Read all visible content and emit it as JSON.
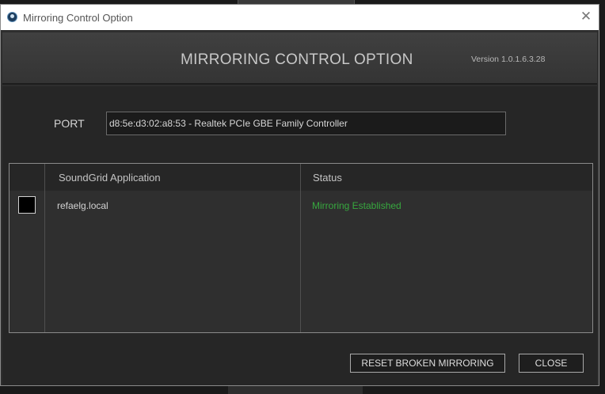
{
  "window": {
    "title": "Mirroring Control Option",
    "close_glyph": "✕"
  },
  "header": {
    "title": "MIRRORING CONTROL OPTION",
    "version": "Version 1.0.1.6.3.28"
  },
  "port": {
    "label": "PORT",
    "value": "d8:5e:d3:02:a8:53 - Realtek PCIe GBE Family Controller"
  },
  "table": {
    "columns": [
      "SoundGrid Application",
      "Status"
    ],
    "rows": [
      {
        "application": "refaelg.local",
        "status": "Mirroring Established",
        "checked": false
      }
    ]
  },
  "buttons": {
    "reset_label": "RESET BROKEN MIRRORING",
    "close_label": "CLOSE"
  },
  "colors": {
    "status_ok": "#37a83f",
    "background": "#262626"
  },
  "icons": {
    "app": "soundgrid-app-icon",
    "close": "close-icon"
  }
}
